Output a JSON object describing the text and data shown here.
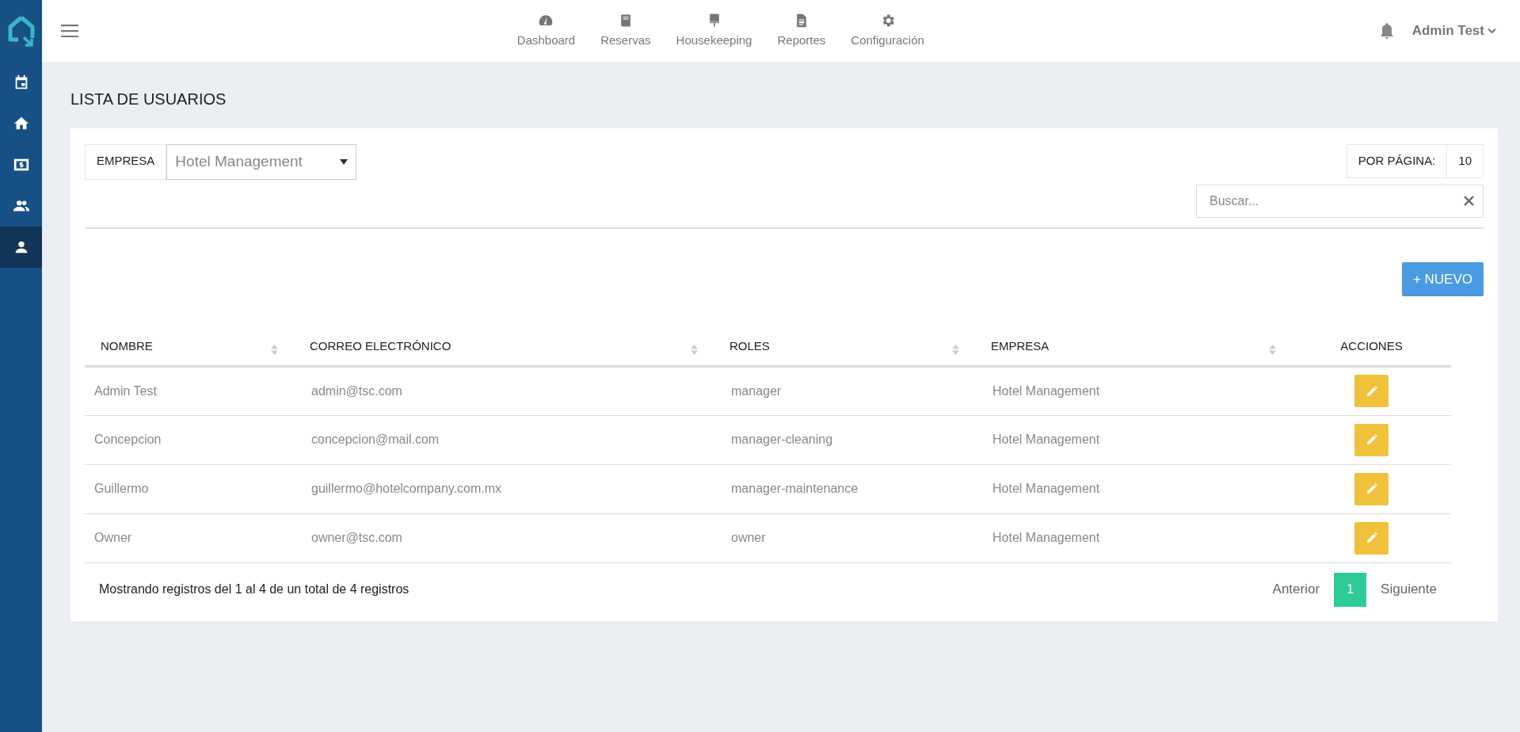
{
  "sidebar": {
    "items": [
      {
        "kind": "calendar",
        "selected": false
      },
      {
        "kind": "home",
        "selected": false
      },
      {
        "kind": "money",
        "selected": false
      },
      {
        "kind": "people",
        "selected": false
      },
      {
        "kind": "person",
        "selected": true
      }
    ]
  },
  "topnav": {
    "items": [
      {
        "kind": "gauge",
        "label": "Dashboard"
      },
      {
        "kind": "book",
        "label": "Reservas"
      },
      {
        "kind": "brush",
        "label": "Housekeeping"
      },
      {
        "kind": "report",
        "label": "Reportes"
      },
      {
        "kind": "gear",
        "label": "Configuración"
      }
    ]
  },
  "user": {
    "name": "Admin Test"
  },
  "page_title": "LISTA DE USUARIOS",
  "filters": {
    "company_label": "EMPRESA",
    "company_value": "Hotel Management",
    "per_page_label": "POR PÁGINA:",
    "per_page_value": "10",
    "search_placeholder": "Buscar..."
  },
  "new_button": "+ NUEVO",
  "table": {
    "columns": [
      {
        "label": "NOMBRE",
        "sortable": true
      },
      {
        "label": "CORREO ELECTRÓNICO",
        "sortable": true
      },
      {
        "label": "ROLES",
        "sortable": true
      },
      {
        "label": "EMPRESA",
        "sortable": true
      },
      {
        "label": "ACCIONES",
        "sortable": false
      }
    ],
    "rows": [
      [
        "Admin Test",
        "admin@tsc.com",
        "manager",
        "Hotel Management"
      ],
      [
        "Concepcion",
        "concepcion@mail.com",
        "manager-cleaning",
        "Hotel Management"
      ],
      [
        "Guillermo",
        "guillermo@hotelcompany.com.mx",
        "manager-maintenance",
        "Hotel Management"
      ],
      [
        "Owner",
        "owner@tsc.com",
        "owner",
        "Hotel Management"
      ]
    ]
  },
  "summary": "Mostrando registros del 1 al 4 de un total de 4 registros",
  "pagination": {
    "previous": "Anterior",
    "pages": [
      {
        "label": "1",
        "selected": true
      }
    ],
    "next": "Siguiente"
  }
}
